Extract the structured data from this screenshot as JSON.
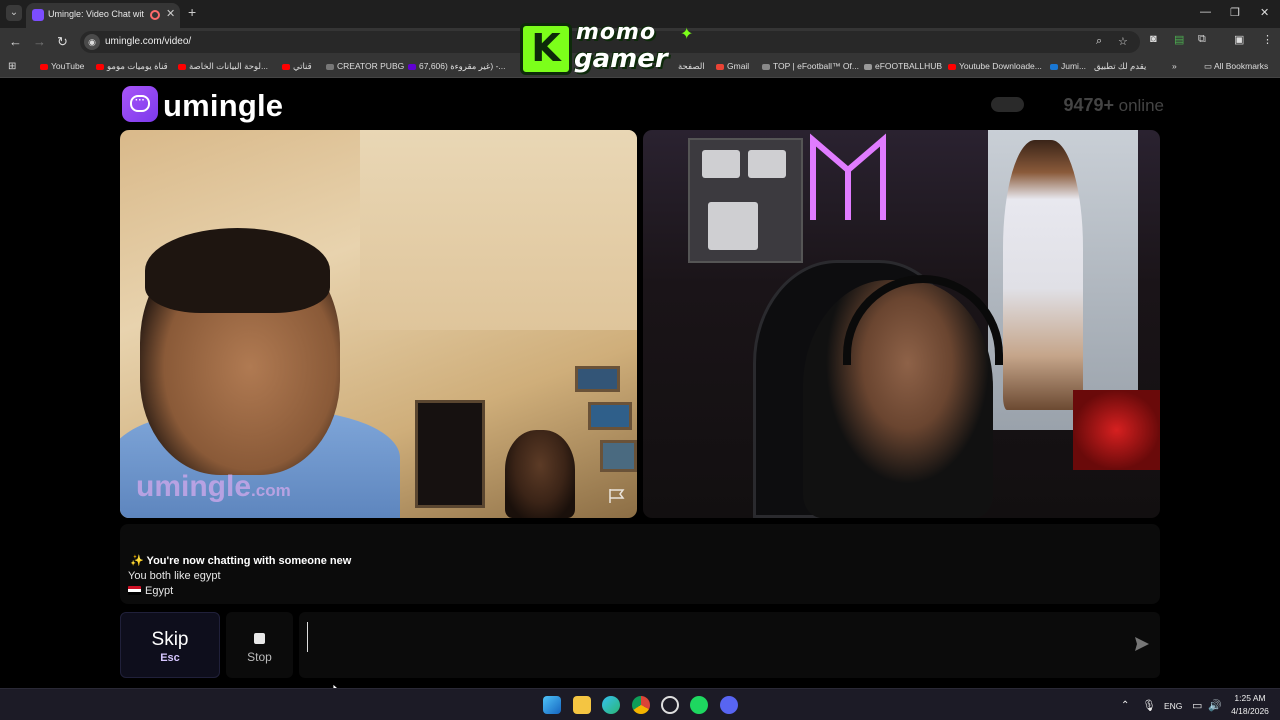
{
  "browser": {
    "tab_title": "Umingle: Video Chat with S",
    "url": "umingle.com/video/",
    "bookmarks": [
      {
        "label": "YouTube",
        "color": "#ff0000"
      },
      {
        "label": "قناة يوميات مومو",
        "color": "#ff0000"
      },
      {
        "label": "لوحة البيانات الخاصة...",
        "color": "#ff0000"
      },
      {
        "label": "قناتي",
        "color": "#ff0000"
      },
      {
        "label": "CREATOR PUBG",
        "color": "#333333"
      },
      {
        "label": "67,606) غير مقروءة) -...",
        "color": "#6001d2"
      },
      {
        "label": "الصفحة",
        "color": "#ff0000"
      },
      {
        "label": "Gmail",
        "color": "#ea4335"
      },
      {
        "label": "TOP | eFootball™ Of...",
        "color": "#444444"
      },
      {
        "label": "eFOOTBALLHUB",
        "color": "#222222"
      },
      {
        "label": "Youtube Downloade...",
        "color": "#ff0000"
      },
      {
        "label": "Jumi...",
        "color": "#1976d2"
      },
      {
        "label": "يقدم لك تطبيق",
        "color": "#ffffff"
      }
    ],
    "all_bookmarks": "All Bookmarks"
  },
  "watermark": {
    "top": "momo",
    "bottom": "gamer",
    "letter": "K"
  },
  "site": {
    "logo_text": "umingle",
    "online_count": "9479+",
    "online_label": "online"
  },
  "video_left": {
    "watermark_main": "umingle",
    "watermark_suffix": ".com"
  },
  "chat": {
    "line1": "✨ You're now chatting with someone new",
    "line2": "You both like egypt",
    "line3": "Egypt"
  },
  "controls": {
    "skip_label": "Skip",
    "skip_key": "Esc",
    "stop_label": "Stop",
    "message_placeholder": ""
  },
  "taskbar": {
    "language": "ENG",
    "time": "1:25 AM",
    "date": "4/18/2026"
  },
  "colors": {
    "accent": "#7c3aed",
    "page_bg": "#000000"
  }
}
